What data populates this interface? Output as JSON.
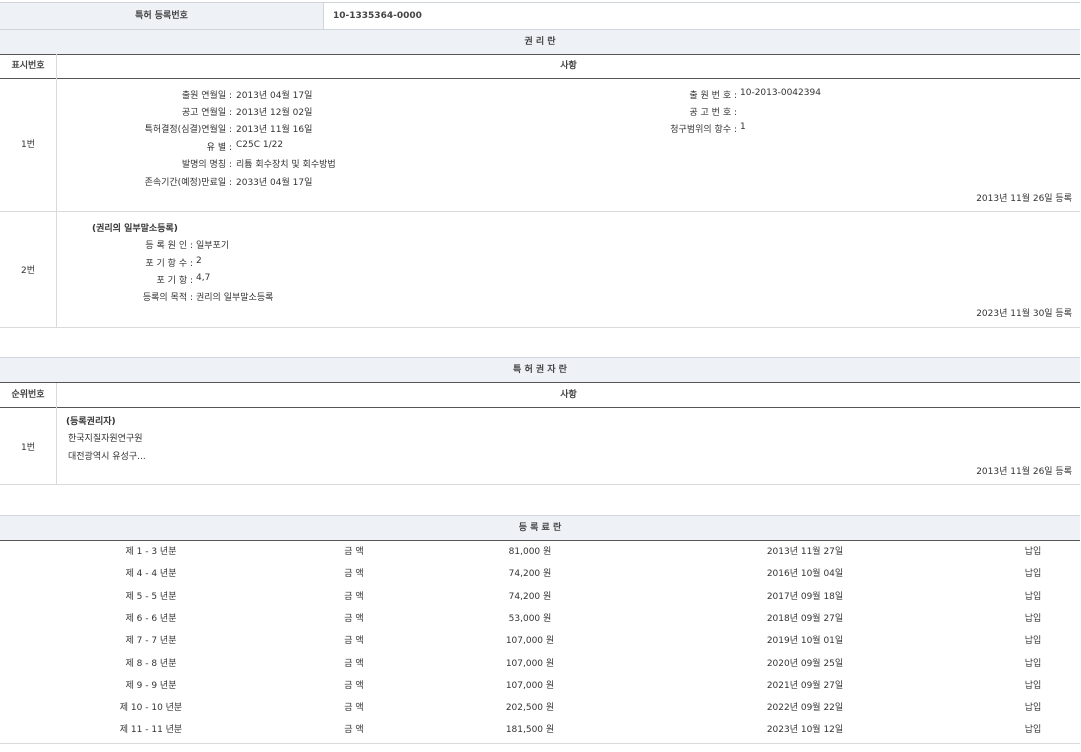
{
  "reg_no": {
    "label": "특허 등록번호",
    "value": "10-1335364-0000"
  },
  "rights": {
    "title": "권 리 란",
    "col_no": "표시번호",
    "col_item": "사항",
    "entry1": {
      "no": "1번",
      "left": [
        {
          "label": "출원 연월일 :",
          "value": "2013년 04월 17일"
        },
        {
          "label": "공고 연월일 :",
          "value": "2013년 12월 02일"
        },
        {
          "label": "특허결정(심결)연월일 :",
          "value": "2013년 11월 16일"
        },
        {
          "label": "유 별 :",
          "value": "C25C 1/22"
        },
        {
          "label": "발명의 명칭 :",
          "value": "리튬 회수장치 및 회수방법"
        },
        {
          "label": "존속기간(예정)만료일 :",
          "value": "2033년 04월 17일"
        }
      ],
      "right": [
        {
          "label": "출 원 번 호 :",
          "value": "10-2013-0042394"
        },
        {
          "label": "공 고 번 호 :",
          "value": ""
        },
        {
          "label": "청구범위의 항수 :",
          "value": "1"
        }
      ],
      "reg_date": "2013년 11월 26일 등록"
    },
    "entry2": {
      "no": "2번",
      "heading": "(권리의 일부말소등록)",
      "rows": [
        {
          "label": "등 록 원 인 :",
          "value": "일부포기"
        },
        {
          "label": "포 기 항 수 :",
          "value": "2"
        },
        {
          "label": "포 기 항 :",
          "value": "4,7"
        },
        {
          "label": "등록의 목적 :",
          "value": "권리의 일부말소등록"
        }
      ],
      "reg_date": "2023년 11월 30일 등록"
    }
  },
  "holder": {
    "title": "특 허 권 자 란",
    "col_no": "순위번호",
    "col_item": "사항",
    "entry1": {
      "no": "1번",
      "heading": "(등록권리자)",
      "name": "한국지질자원연구원",
      "address": "대전광역시 유성구...",
      "reg_date": "2013년 11월 26일 등록"
    }
  },
  "fees": {
    "title": "등 록 료 란",
    "rows": [
      {
        "period": "제 1 - 3 년분",
        "label": "금 액",
        "amount": "81,000 원",
        "date": "2013년 11월 27일",
        "status": "납입"
      },
      {
        "period": "제 4 - 4 년분",
        "label": "금 액",
        "amount": "74,200 원",
        "date": "2016년 10월 04일",
        "status": "납입"
      },
      {
        "period": "제 5 - 5 년분",
        "label": "금 액",
        "amount": "74,200 원",
        "date": "2017년 09월 18일",
        "status": "납입"
      },
      {
        "period": "제 6 - 6 년분",
        "label": "금 액",
        "amount": "53,000 원",
        "date": "2018년 09월 27일",
        "status": "납입"
      },
      {
        "period": "제 7 - 7 년분",
        "label": "금 액",
        "amount": "107,000 원",
        "date": "2019년 10월 01일",
        "status": "납입"
      },
      {
        "period": "제 8 - 8 년분",
        "label": "금 액",
        "amount": "107,000 원",
        "date": "2020년 09월 25일",
        "status": "납입"
      },
      {
        "period": "제 9 - 9 년분",
        "label": "금 액",
        "amount": "107,000 원",
        "date": "2021년 09월 27일",
        "status": "납입"
      },
      {
        "period": "제 10 - 10 년분",
        "label": "금 액",
        "amount": "202,500 원",
        "date": "2022년 09월 22일",
        "status": "납입"
      },
      {
        "period": "제 11 - 11 년분",
        "label": "금 액",
        "amount": "181,500 원",
        "date": "2023년 10월 12일",
        "status": "납입"
      }
    ]
  }
}
